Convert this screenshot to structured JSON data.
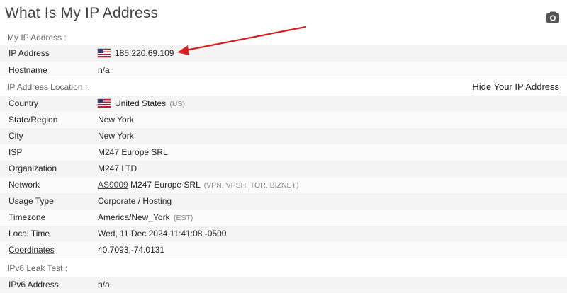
{
  "page": {
    "title": "What Is My IP Address"
  },
  "toolbar": {
    "camera_icon": "camera-icon"
  },
  "sections": {
    "my_ip": "My IP Address :",
    "location": "IP Address Location :",
    "ipv6": "IPv6 Leak Test :"
  },
  "links": {
    "hide_ip": "Hide Your IP Address"
  },
  "ip": {
    "label": "IP Address",
    "value": "185.220.69.109",
    "hostname_label": "Hostname",
    "hostname_value": "n/a"
  },
  "location": {
    "country_label": "Country",
    "country_value": "United States",
    "country_code": "(US)",
    "state_label": "State/Region",
    "state_value": "New York",
    "city_label": "City",
    "city_value": "New York",
    "isp_label": "ISP",
    "isp_value": "M247 Europe SRL",
    "org_label": "Organization",
    "org_value": "M247 LTD",
    "network_label": "Network",
    "network_asn": "AS9009",
    "network_name": "M247 Europe SRL",
    "network_tags": "(VPN, VPSH, TOR, BIZNET)",
    "usage_label": "Usage Type",
    "usage_value": "Corporate / Hosting",
    "tz_label": "Timezone",
    "tz_value": "America/New_York",
    "tz_abbr": "(EST)",
    "localtime_label": "Local Time",
    "localtime_value": "Wed, 11 Dec 2024 11:41:08 -0500",
    "coords_label": "Coordinates",
    "coords_value": "40.7093,-74.0131"
  },
  "ipv6": {
    "label": "IPv6 Address",
    "value": "n/a"
  },
  "colors": {
    "arrow": "#d92020",
    "row_bg": "#f4f4f4",
    "title": "#444444"
  }
}
